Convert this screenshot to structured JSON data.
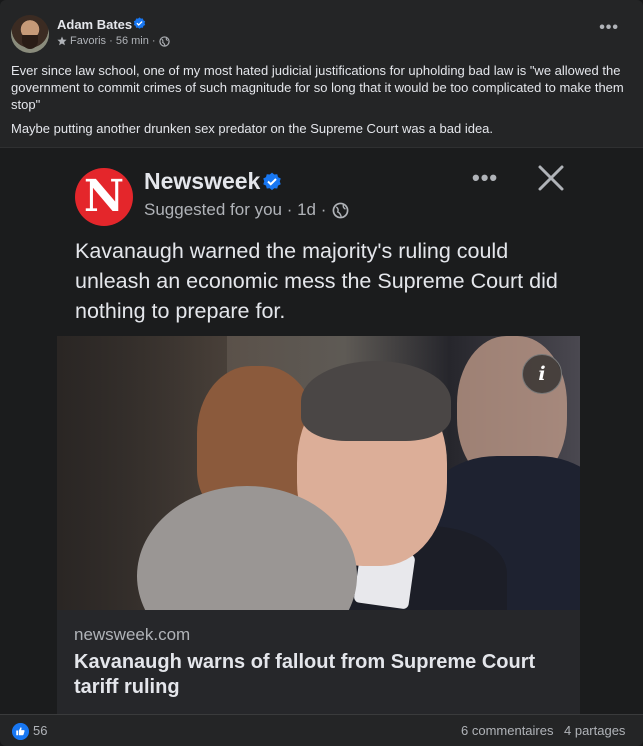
{
  "post": {
    "author": "Adam Bates",
    "meta": "Favoris · 56 min ·",
    "paragraphs": [
      "Ever since law school, one of my most hated judicial justifications for upholding bad law is \"we allowed the government to commit crimes of such magnitude for so long that it would be too complicated to make them stop\"",
      "Maybe putting another drunken sex predator on the Supreme Court was a bad idea."
    ]
  },
  "shared": {
    "logo_letter": "N",
    "publisher": "Newsweek",
    "suggestion": "Suggested for you · 1d ·",
    "headline": "Kavanaugh warned the majority's ruling could unleash an economic mess the Supreme Court did nothing to prepare for.",
    "info_glyph": "i",
    "link": {
      "domain": "newsweek.com",
      "title": "Kavanaugh warns of fallout from Supreme Court tariff ruling"
    }
  },
  "footer": {
    "reactions": "56",
    "comments": "6 commentaires",
    "shares": "4 partages"
  },
  "colors": {
    "background": "#242526",
    "accent": "#1877f2",
    "newsweek_red": "#e4262b"
  },
  "icons": [
    "star-icon",
    "globe-icon",
    "verified-icon",
    "more-icon",
    "close-icon",
    "info-icon",
    "like-icon"
  ]
}
